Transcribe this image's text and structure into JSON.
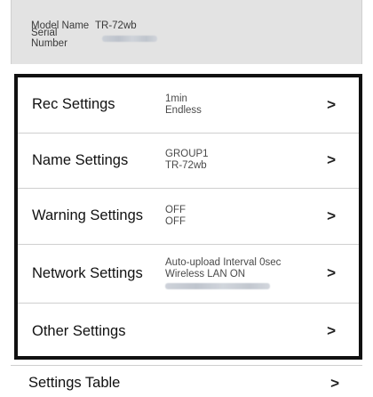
{
  "device": {
    "model_label": "Model Name",
    "model_value": "TR-72wb",
    "serial_label": "Serial Number",
    "serial_value_obscured": true
  },
  "settings": [
    {
      "title": "Rec Settings",
      "values": [
        "1min",
        "Endless"
      ]
    },
    {
      "title": "Name Settings",
      "values": [
        "GROUP1",
        "TR-72wb"
      ]
    },
    {
      "title": "Warning Settings",
      "values": [
        "OFF",
        "OFF"
      ]
    },
    {
      "title": "Network Settings",
      "values": [
        "Auto-upload Interval 0sec",
        "Wireless LAN ON"
      ],
      "has_obscured_line": true
    },
    {
      "title": "Other Settings",
      "values": []
    }
  ],
  "settings_table": {
    "title": "Settings Table"
  },
  "chevron_glyph": ">",
  "colors": {
    "header_bg": "#e3e3e3",
    "highlight_border": "#111111",
    "divider": "#cfcfcf"
  }
}
